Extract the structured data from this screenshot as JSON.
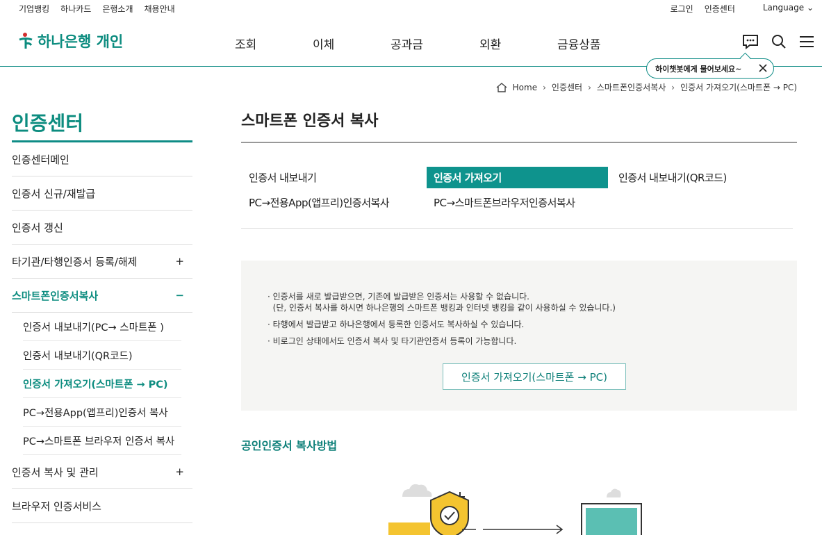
{
  "topbar": {
    "links": [
      "기업뱅킹",
      "하나카드",
      "은행소개",
      "채용안내"
    ],
    "login": "로그인",
    "cert_center": "인증센터",
    "language": "Language"
  },
  "header": {
    "logo": "하나은행 개인",
    "gnb": [
      "조회",
      "이체",
      "공과금",
      "외환",
      "금융상품"
    ],
    "chat_bubble": "하이챗봇에게 물어보세요~"
  },
  "breadcrumb": [
    "Home",
    "인증센터",
    "스마트폰인증서복사",
    "인증서 가져오기(스마트폰 → PC)"
  ],
  "lnb": {
    "title": "인증센터",
    "items": [
      {
        "label": "인증센터메인",
        "toggle": ""
      },
      {
        "label": "인증서 신규/재발급",
        "toggle": ""
      },
      {
        "label": "인증서 갱신",
        "toggle": ""
      },
      {
        "label": "타기관/타행인증서 등록/해제",
        "toggle": "+"
      },
      {
        "label": "스마트폰인증서복사",
        "toggle": "−"
      }
    ],
    "subitems": [
      "인증서 내보내기(PC→ 스마트폰 )",
      "인증서 내보내기(QR코드)",
      "인증서 가져오기(스마트폰 → PC)",
      "PC→전용App(앱프리)인증서 복사",
      "PC→스마트폰 브라우저 인증서 복사"
    ],
    "items_after": [
      {
        "label": "인증서 복사 및 관리",
        "toggle": "+"
      },
      {
        "label": "브라우저 인증서비스",
        "toggle": ""
      }
    ]
  },
  "main": {
    "title": "스마트폰 인증서 복사",
    "tabs": [
      "인증서 내보내기",
      "인증서 가져오기",
      "인증서 내보내기(QR코드)",
      "PC→전용App(앱프리)인증서복사",
      "PC→스마트폰브라우저인증서복사"
    ],
    "notice": [
      "인증서를 새로 발급받으면, 기존에 발급받은 인증서는 사용할 수 없습니다.",
      "(단, 인증서 복사를 하시면 하나은행의 스마트폰 뱅킹과 인터넷 뱅킹을 같이 사용하실 수 있습니다.)",
      "타행에서 발급받고 하나은행에서 등록한 인증서도 복사하실 수 있습니다.",
      "비로그인 상태에서도 인증서 복사 및 타기관인증서 등록이 가능합니다."
    ],
    "button": "인증서 가져오기(스마트폰 → PC)",
    "subhead": "공인인증서 복사방법"
  },
  "colors": {
    "brand": "#0e938d",
    "brand_dark": "#0c8c7f"
  }
}
